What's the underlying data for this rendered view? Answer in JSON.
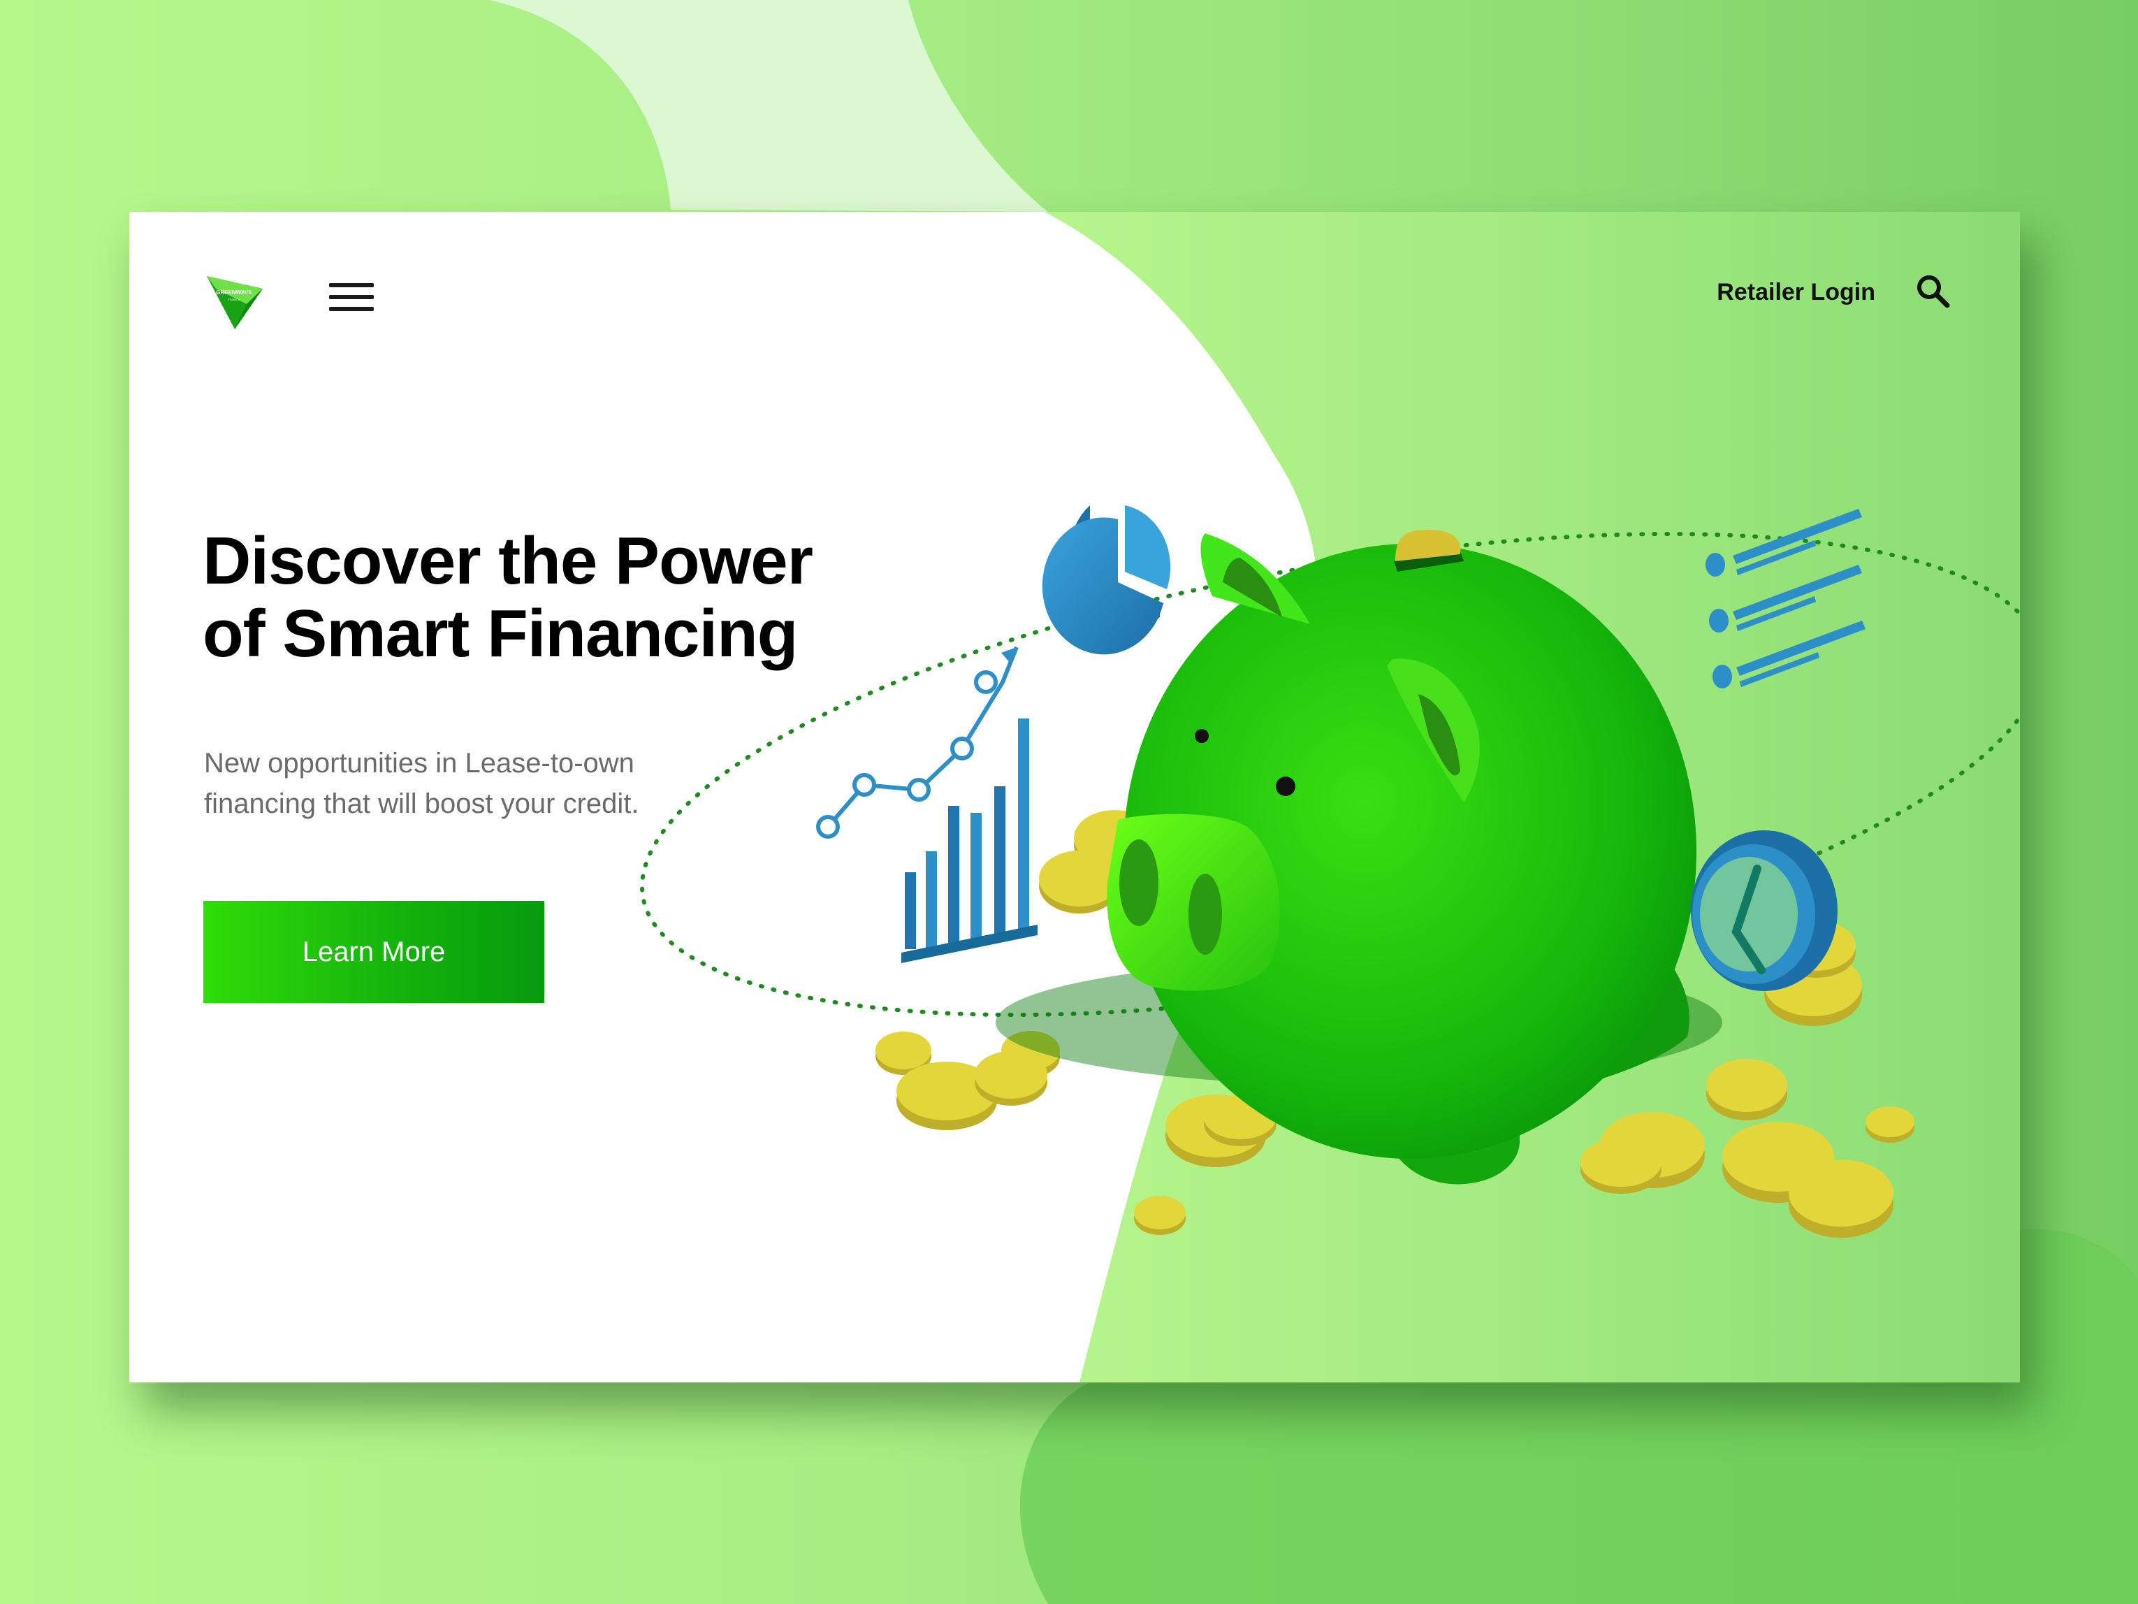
{
  "brand": {
    "logo_text": "GREENWAVE",
    "logo_subtext": "FINANCE",
    "logo_icon": "green-triangle-logo",
    "colors": {
      "primary": "#13b30c",
      "accent_light": "#5af010",
      "coin": "#e3d63a",
      "chart_blue": "#2d8fc8"
    }
  },
  "header": {
    "menu_icon": "hamburger-menu-icon",
    "retailer_login_label": "Retailer Login",
    "search_icon": "magnifier-search-icon"
  },
  "hero": {
    "title_line1": "Discover the Power",
    "title_line2": "of Smart Financing",
    "subtitle_line1": "New opportunities in Lease-to-own",
    "subtitle_line2": "financing that will boost your credit.",
    "cta_label": "Learn More"
  },
  "illustration": {
    "subject": "piggy-bank-illustration",
    "items": [
      "pie-chart-icon",
      "line-chart-icon",
      "bar-chart-icon",
      "list-icon",
      "clock-icon",
      "gold-coins"
    ]
  }
}
